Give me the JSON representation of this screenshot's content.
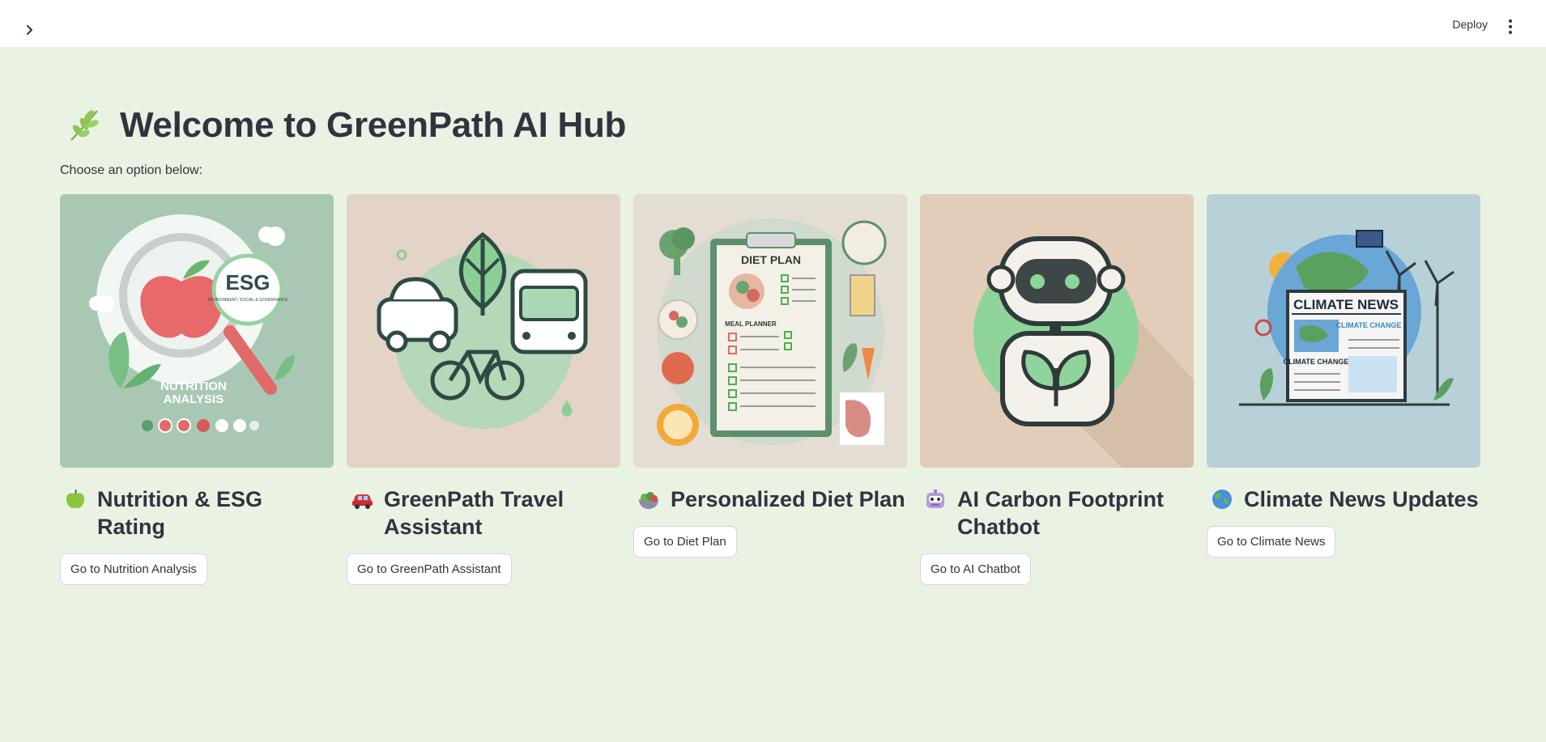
{
  "header": {
    "deploy_label": "Deploy",
    "sidebar_toggle_icon": "chevron-right-icon",
    "menu_icon": "vertical-ellipsis-icon"
  },
  "main": {
    "title": "Welcome to GreenPath AI Hub",
    "title_icon": "herb-icon",
    "subtitle": "Choose an option below:"
  },
  "cards": [
    {
      "title": "Nutrition & ESG Rating",
      "icon": "green-apple-icon",
      "button": "Go to Nutrition Analysis",
      "image_texts": [
        "ESG",
        "ENVIRONMENT, SOCIAL & GOVERNANCE",
        "NUTRITION",
        "ANALYSIS"
      ]
    },
    {
      "title": "GreenPath Travel Assistant",
      "icon": "car-icon",
      "button": "Go to GreenPath Assistant"
    },
    {
      "title": "Personalized Diet Plan",
      "icon": "salad-bowl-icon",
      "button": "Go to Diet Plan",
      "image_texts": [
        "DIET PLAN",
        "MEAL PLANNER"
      ]
    },
    {
      "title": "AI Carbon Footprint Chatbot",
      "icon": "robot-icon",
      "button": "Go to AI Chatbot"
    },
    {
      "title": "Climate News Updates",
      "icon": "globe-icon",
      "button": "Go to Climate News",
      "image_texts": [
        "CLIMATE NEWS",
        "CLIMATE CHANGE",
        "CLIMATE CHANGE"
      ]
    }
  ],
  "colors": {
    "background": "#eaf3e3",
    "header": "#ffffff",
    "text": "#31333f",
    "accent_green": "#8fcf9a"
  }
}
